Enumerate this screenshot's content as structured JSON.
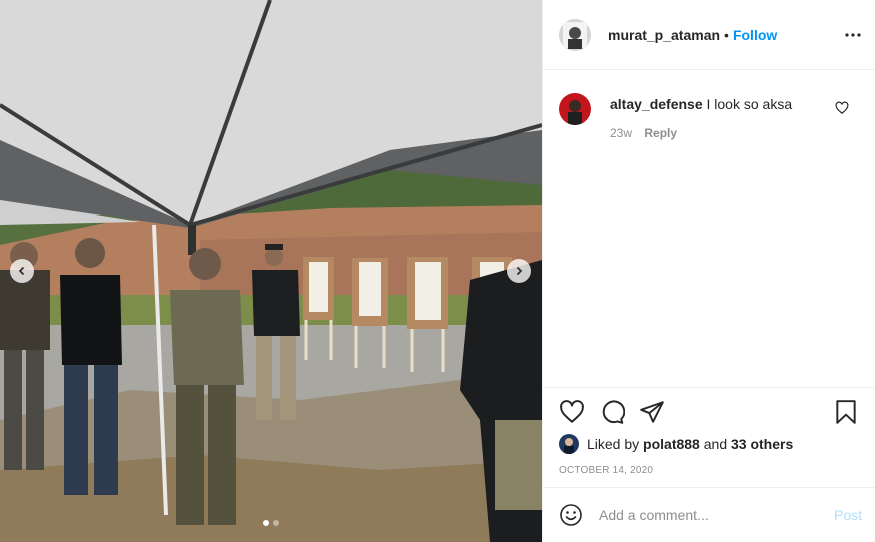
{
  "post": {
    "author": "murat_p_ataman",
    "separator": "•",
    "follow_label": "Follow",
    "more_icon": "more-horizontal-icon"
  },
  "photo": {
    "carousel_count": 2,
    "active_index": 0,
    "prev_icon": "chevron-left-icon",
    "next_icon": "chevron-right-icon"
  },
  "comments": [
    {
      "user": "altay_defense",
      "text": "I look so aksa",
      "age": "23w",
      "reply_label": "Reply"
    }
  ],
  "likes": {
    "prefix": "Liked by ",
    "user": "polat888",
    "middle": " and ",
    "others": "33 others"
  },
  "date": "OCTOBER 14, 2020",
  "composer": {
    "placeholder": "Add a comment...",
    "post_label": "Post"
  },
  "colors": {
    "accent": "#0095f6",
    "post_disabled": "#b2dffc",
    "muted": "#8e8e8e",
    "text": "#262626"
  }
}
